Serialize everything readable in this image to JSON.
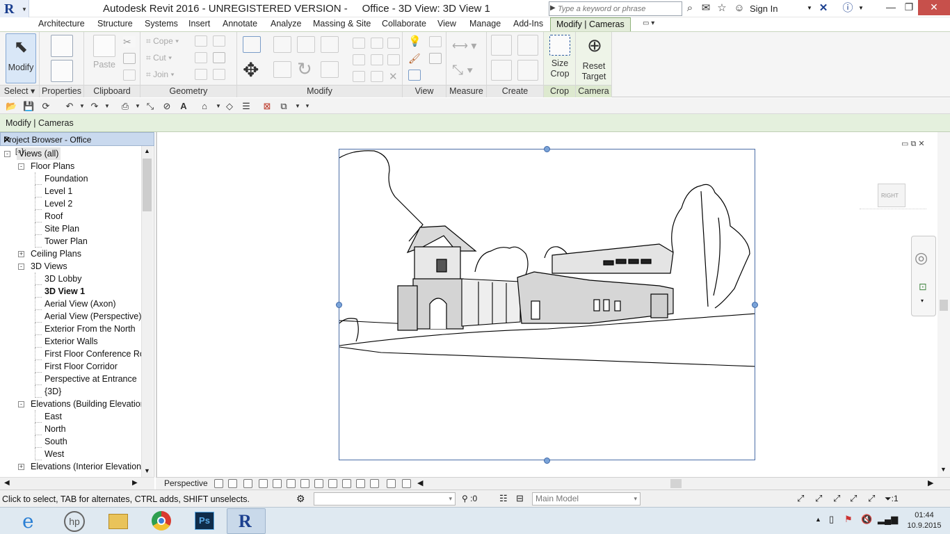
{
  "app": {
    "logo_letter": "R",
    "title_left": "Autodesk Revit 2016 - UNREGISTERED VERSION -",
    "title_right": "Office - 3D View: 3D View 1",
    "search_placeholder": "Type a keyword or phrase",
    "sign_in": "Sign In"
  },
  "ribbon_tabs": [
    "Architecture",
    "Structure",
    "Systems",
    "Insert",
    "Annotate",
    "Analyze",
    "Massing & Site",
    "Collaborate",
    "View",
    "Manage",
    "Add-Ins",
    "Modify | Cameras"
  ],
  "active_tab": "Modify | Cameras",
  "ribbon": {
    "modify": "Modify",
    "select": "Select",
    "paste": "Paste",
    "cope": "Cope",
    "cut": "Cut",
    "join": "Join",
    "size_crop_1": "Size",
    "size_crop_2": "Crop",
    "reset_target_1": "Reset",
    "reset_target_2": "Target",
    "panels": {
      "select": "Select",
      "properties": "Properties",
      "clipboard": "Clipboard",
      "geometry": "Geometry",
      "modify": "Modify",
      "view": "View",
      "measure": "Measure",
      "create": "Create",
      "crop": "Crop",
      "camera": "Camera"
    }
  },
  "context_bar": "Modify | Cameras",
  "project_browser": {
    "title": "Project Browser - Office",
    "items": [
      {
        "label": "Views (all)",
        "level": 0,
        "toggle": "-",
        "bold": false
      },
      {
        "label": "Floor Plans",
        "level": 1,
        "toggle": "-",
        "bold": false
      },
      {
        "label": "Foundation",
        "level": 2,
        "toggle": "",
        "bold": false
      },
      {
        "label": "Level 1",
        "level": 2,
        "toggle": "",
        "bold": false
      },
      {
        "label": "Level 2",
        "level": 2,
        "toggle": "",
        "bold": false
      },
      {
        "label": "Roof",
        "level": 2,
        "toggle": "",
        "bold": false
      },
      {
        "label": "Site Plan",
        "level": 2,
        "toggle": "",
        "bold": false
      },
      {
        "label": "Tower Plan",
        "level": 2,
        "toggle": "",
        "bold": false
      },
      {
        "label": "Ceiling Plans",
        "level": 1,
        "toggle": "+",
        "bold": false
      },
      {
        "label": "3D Views",
        "level": 1,
        "toggle": "-",
        "bold": false
      },
      {
        "label": "3D Lobby",
        "level": 2,
        "toggle": "",
        "bold": false
      },
      {
        "label": "3D View 1",
        "level": 2,
        "toggle": "",
        "bold": true
      },
      {
        "label": "Aerial View (Axon)",
        "level": 2,
        "toggle": "",
        "bold": false
      },
      {
        "label": "Aerial View (Perspective)",
        "level": 2,
        "toggle": "",
        "bold": false
      },
      {
        "label": "Exterior From the North",
        "level": 2,
        "toggle": "",
        "bold": false
      },
      {
        "label": "Exterior Walls",
        "level": 2,
        "toggle": "",
        "bold": false
      },
      {
        "label": "First Floor Conference Ro",
        "level": 2,
        "toggle": "",
        "bold": false
      },
      {
        "label": "First Floor Corridor",
        "level": 2,
        "toggle": "",
        "bold": false
      },
      {
        "label": "Perspective at Entrance",
        "level": 2,
        "toggle": "",
        "bold": false
      },
      {
        "label": "{3D}",
        "level": 2,
        "toggle": "",
        "bold": false
      },
      {
        "label": "Elevations (Building Elevation",
        "level": 1,
        "toggle": "-",
        "bold": false
      },
      {
        "label": "East",
        "level": 2,
        "toggle": "",
        "bold": false
      },
      {
        "label": "North",
        "level": 2,
        "toggle": "",
        "bold": false
      },
      {
        "label": "South",
        "level": 2,
        "toggle": "",
        "bold": false
      },
      {
        "label": "West",
        "level": 2,
        "toggle": "",
        "bold": false
      },
      {
        "label": "Elevations (Interior Elevation",
        "level": 1,
        "toggle": "+",
        "bold": false
      }
    ]
  },
  "viewcube": {
    "face": "RIGHT"
  },
  "view_control": {
    "projection": "Perspective"
  },
  "status": {
    "message": "Click to select, TAB for alternates, CTRL adds, SHIFT unselects.",
    "selection_count": ":0",
    "model": "Main Model",
    "filter_count": ":1"
  },
  "taskbar": {
    "time": "01:44",
    "date": "10.9.2015"
  },
  "colors": {
    "accent": "#1b3f8f",
    "ribbon_green": "#e3ecda",
    "crop_frame": "#4a6da6",
    "close_red": "#c7504b"
  }
}
